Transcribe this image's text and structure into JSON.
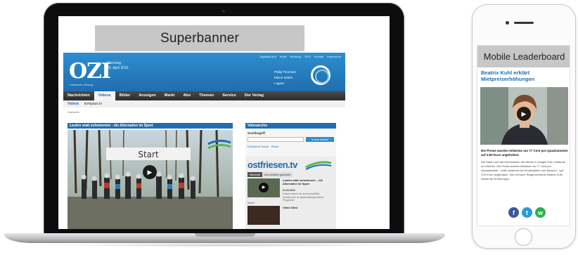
{
  "laptop": {
    "superbanner_label": "Superbanner",
    "site": {
      "utility_links": [
        "Digitales Abo",
        "Kiosk",
        "Aboshop",
        "RSS",
        "Kontakt",
        "Impressum"
      ],
      "logo": "OZI",
      "logo_subtitle": "Ostfriesen-Zeitung",
      "date_line1": "Dienstag,",
      "date_line2": "05. April 2016",
      "user": {
        "name": "Philip Thomsen",
        "link_profile": "Meine Seiten",
        "link_logout": "Logout"
      },
      "nav_items": [
        "Nachrichten",
        "Videos",
        "Bilder",
        "Anzeigen",
        "Markt",
        "Abo",
        "Themen",
        "Service",
        "Der Verlag"
      ],
      "nav_active": "Videos",
      "subnav_active": "Videos",
      "subnav_item": "kompass.tv",
      "breadcrumb": "Startseite",
      "main_heading": "Laufen statt schwimmen - die Alternative im Sport",
      "video_banner_text": "Start",
      "sidebar": {
        "heading": "Videoarchiv",
        "search_label": "Suchbegriff",
        "search_button": "Suche starten",
        "link_advanced": "Erweiterte Suche",
        "link_reset": "Reset"
      },
      "ostfriesen": {
        "logo": "ostfriesen.tv",
        "tab_news": "Neueste",
        "tab_active": "Am meisten gesehen",
        "items": [
          {
            "title": "Laufen statt schwimmen – die Alternative im Sport",
            "date": "01.03.2016",
            "text": "Frauen waren ein durchschnittlich Schwimmen im abwechslungsreichen Programm"
          },
          {
            "title": "Video Obst",
            "date": "",
            "text": ""
          }
        ],
        "more_label": "Sehen"
      }
    }
  },
  "phone": {
    "leaderboard_label": "Mobile Leaderboard",
    "article_title": "Beatrix Kuhl erklärt Mietpreiserhöhungen",
    "caption": "Die Preise wurden teilweise um 77 Cent pro Quadratmeter auf 3,50 Euro angehoben.",
    "body": "Die Stadt Leer hat beschlossen die Mieten in einigen ihrer Gebäude zu erhöhen. Die Preise wurden teilweise um 77 Cent pro Quadratmeter - unter anderem bei Kindergärten und Museen - auf 3,50 Euro angehoben. Die Leeraner Bürgermeisterin Beatrix Kuhl erklärt die Erhöhungen.",
    "share": {
      "facebook": "f",
      "twitter": "t",
      "whatsapp": "w"
    }
  },
  "colors": {
    "brand_blue": "#1f6eaf",
    "banner_gray": "#c7c7c7",
    "nav_dark": "#2c2c2c",
    "facebook": "#3b5998",
    "twitter": "#2b9ad8",
    "whatsapp": "#2bb24c"
  },
  "icons": [
    "play-icon",
    "facebook-icon",
    "twitter-icon",
    "whatsapp-icon"
  ]
}
